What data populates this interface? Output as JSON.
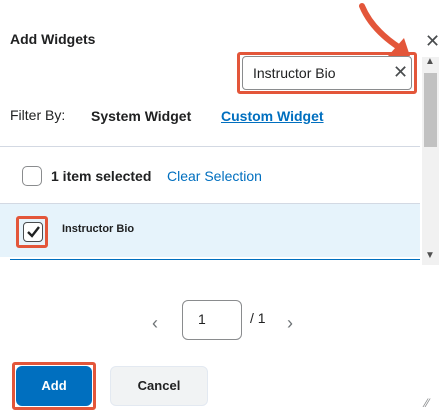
{
  "dialog": {
    "title": "Add Widgets",
    "close_icon": "close-icon"
  },
  "search": {
    "value": "Instructor Bio",
    "clear_icon": "clear-search-icon"
  },
  "filter": {
    "label": "Filter By:",
    "options": [
      "System Widget",
      "Custom Widget"
    ],
    "active": "Custom Widget"
  },
  "selection": {
    "status": "1 item selected",
    "clear_label": "Clear Selection"
  },
  "list": {
    "items": [
      {
        "label": "Instructor Bio",
        "checked": true
      }
    ]
  },
  "pagination": {
    "current_page": "1",
    "total": "/ 1",
    "prev_icon": "chevron-left-icon",
    "next_icon": "chevron-right-icon"
  },
  "actions": {
    "add_label": "Add",
    "cancel_label": "Cancel"
  },
  "colors": {
    "accent": "#006fbf",
    "highlight": "#e3563a",
    "row_selected_bg": "#e6f3fb"
  }
}
